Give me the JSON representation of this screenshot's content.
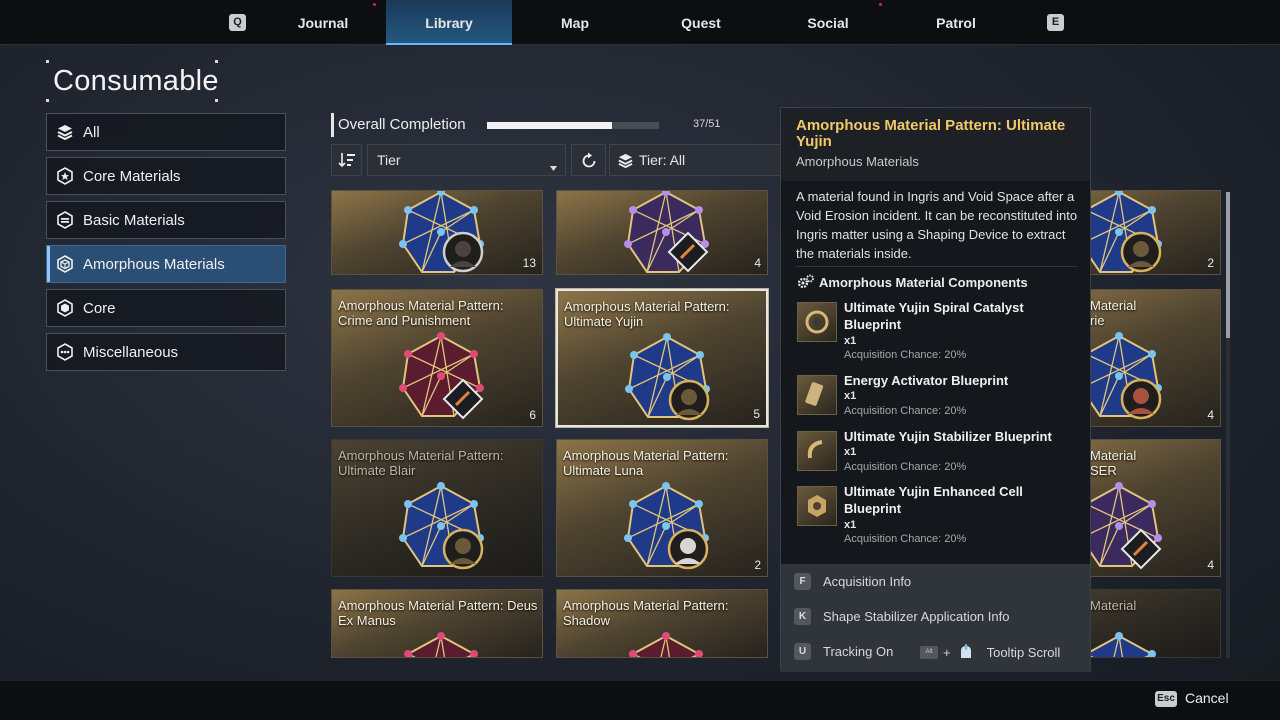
{
  "nav": {
    "left_key": "Q",
    "right_key": "E",
    "tabs": [
      {
        "label": "Journal",
        "badge": true
      },
      {
        "label": "Library",
        "active": true
      },
      {
        "label": "Map"
      },
      {
        "label": "Quest"
      },
      {
        "label": "Social",
        "badge": true
      },
      {
        "label": "Patrol"
      }
    ]
  },
  "page_title": "Consumable",
  "sidebar": {
    "items": [
      {
        "label": "All",
        "icon": "layers-icon"
      },
      {
        "label": "Core Materials",
        "icon": "hex-star-icon"
      },
      {
        "label": "Basic Materials",
        "icon": "hex-box-icon"
      },
      {
        "label": "Amorphous Materials",
        "icon": "hex-cube-icon",
        "active": true
      },
      {
        "label": "Core",
        "icon": "hex-core-icon"
      },
      {
        "label": "Miscellaneous",
        "icon": "hex-dots-icon"
      }
    ]
  },
  "completion": {
    "label": "Overall Completion",
    "value_text": "37/51",
    "fraction": 0.7255
  },
  "filters": {
    "sort_label": "Tier",
    "tier_label": "Tier: All"
  },
  "cards": [
    {
      "name": "",
      "count": "13",
      "gem": "blue",
      "badge": "portrait-dark",
      "dim": false
    },
    {
      "name": "",
      "count": "4",
      "gem": "purple",
      "badge": "diamond",
      "dim": false
    },
    {
      "name": "",
      "count": "2",
      "gem": "blue",
      "badge": "portrait-gold",
      "dim": false
    },
    {
      "name": "Amorphous Material Pattern: Crime and Punishment",
      "count": "6",
      "gem": "red",
      "badge": "diamond",
      "dim": false
    },
    {
      "name": "Amorphous Material Pattern: Ultimate Yujin",
      "count": "5",
      "gem": "blue",
      "badge": "portrait-gold",
      "dim": false,
      "selected": true
    },
    {
      "name": "Material",
      "sub": "rie",
      "count": "4",
      "gem": "blue",
      "badge": "portrait-red",
      "dim": false
    },
    {
      "name": "Amorphous Material Pattern: Ultimate Blair",
      "count": "",
      "gem": "blue",
      "badge": "portrait-gold",
      "dim": true
    },
    {
      "name": "Amorphous Material Pattern: Ultimate Luna",
      "count": "2",
      "gem": "blue",
      "badge": "portrait-light",
      "dim": false
    },
    {
      "name": "Material",
      "sub": "SER",
      "count": "4",
      "gem": "purple",
      "badge": "diamond",
      "dim": false
    },
    {
      "name": "Amorphous Material Pattern: Deus Ex Manus",
      "count": "",
      "gem": "red",
      "badge": "",
      "dim": false
    },
    {
      "name": "Amorphous Material Pattern: Shadow",
      "count": "",
      "gem": "red",
      "badge": "",
      "dim": false
    },
    {
      "name": "Material",
      "count": "",
      "gem": "blue",
      "badge": "",
      "dim": true
    }
  ],
  "tooltip": {
    "title": "Amorphous Material Pattern: Ultimate Yujin",
    "subtitle": "Amorphous Materials",
    "description": "A material found in Ingris and Void Space after a Void Erosion incident. It can be reconstituted into Ingris matter using a Shaping Device to extract the materials inside.",
    "components_header": "Amorphous Material Components",
    "components": [
      {
        "name": "Ultimate Yujin Spiral Catalyst Blueprint",
        "qty": "x1",
        "chance": "Acquisition Chance: 20%"
      },
      {
        "name": "Energy Activator Blueprint",
        "qty": "x1",
        "chance": "Acquisition Chance: 20%"
      },
      {
        "name": "Ultimate Yujin Stabilizer Blueprint",
        "qty": "x1",
        "chance": "Acquisition Chance: 20%"
      },
      {
        "name": "Ultimate Yujin Enhanced Cell Blueprint",
        "qty": "x1",
        "chance": "Acquisition Chance: 20%"
      }
    ],
    "actions": [
      {
        "key": "F",
        "label": "Acquisition Info"
      },
      {
        "key": "K",
        "label": "Shape Stabilizer Application Info"
      },
      {
        "key": "U",
        "label": "Tracking On"
      }
    ],
    "scroll_hint": {
      "key": "Alt",
      "plus": "+",
      "label": "Tooltip Scroll"
    }
  },
  "footer": {
    "key": "Esc",
    "label": "Cancel"
  }
}
